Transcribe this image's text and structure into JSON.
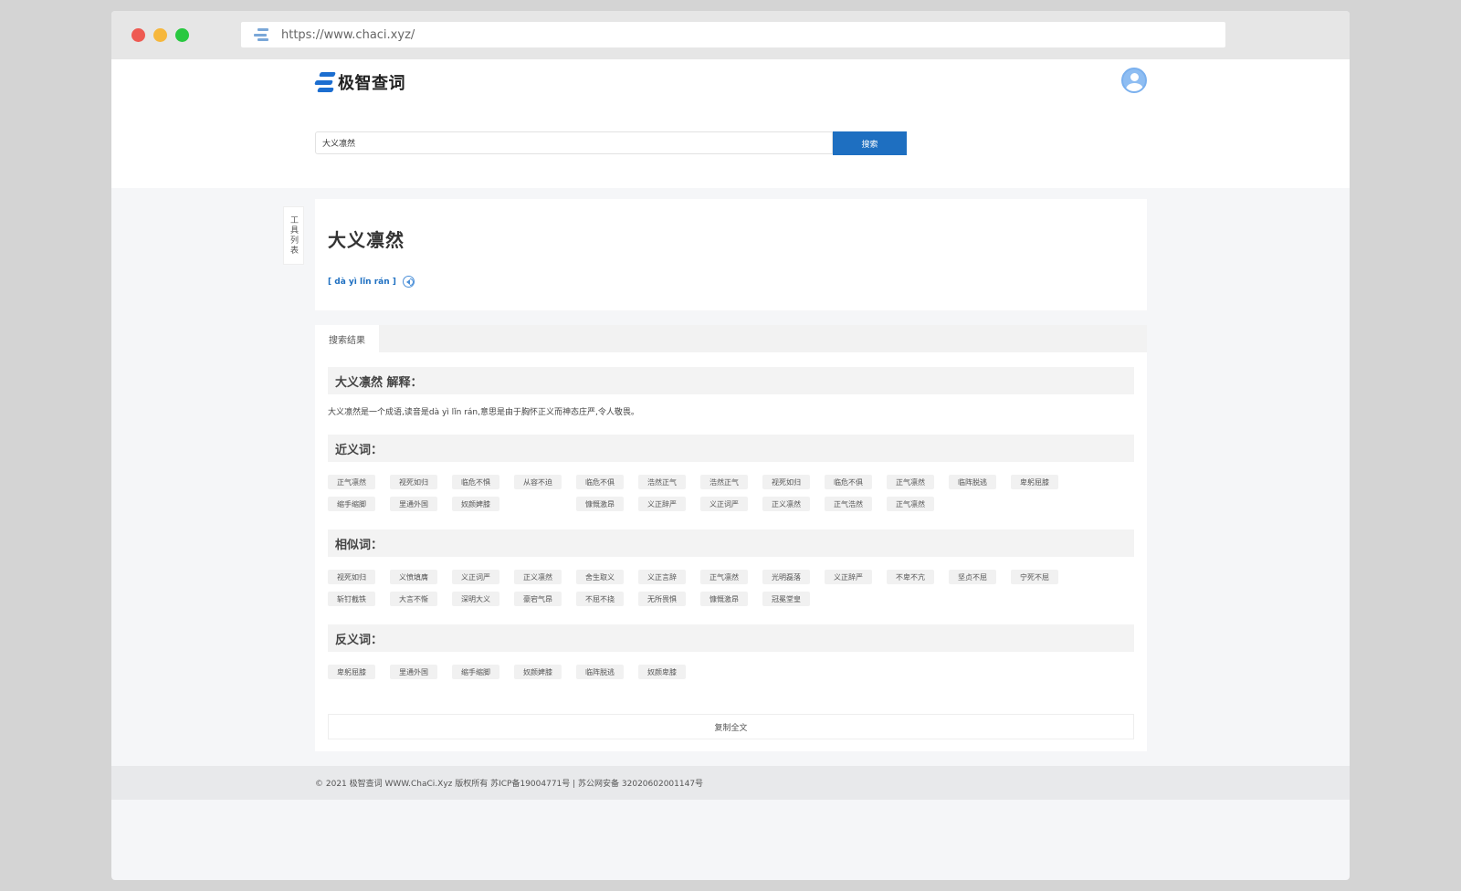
{
  "browser": {
    "url": "https://www.chaci.xyz/"
  },
  "header": {
    "logo_text": "极智查词"
  },
  "search": {
    "value": "大义凛然",
    "button_label": "搜索"
  },
  "side_tab": {
    "label": "工具列表"
  },
  "word": {
    "title": "大义凛然",
    "pinyin": "[ dà yì lǐn rán ]"
  },
  "results": {
    "tab_label": "搜索结果",
    "explain_heading": "大义凛然 解释：",
    "explain_text": "大义凛然是一个成语,读音是dà yì lǐn rán,意思是由于胸怀正义而神态庄严,令人敬畏。",
    "synonyms_heading": "近义词：",
    "synonyms": [
      "正气凛然",
      "视死如归",
      "临危不惧",
      "从容不迫",
      "临危不俱",
      "浩然正气",
      "浩然正气",
      "视死如归",
      "临危不俱",
      "正气凛然",
      "临阵脱逃",
      "卑躬屈膝",
      "缩手缩脚",
      "里通外国",
      "奴颜婢膝",
      "",
      "慷慨激昂",
      "义正辞严",
      "义正词严",
      "正义凛然",
      "正气浩然",
      "正气凛然"
    ],
    "similar_heading": "相似词：",
    "similar": [
      "视死如归",
      "义愤填膺",
      "义正词严",
      "正义凛然",
      "舍生取义",
      "义正言辞",
      "正气凛然",
      "光明磊落",
      "义正辞严",
      "不卑不亢",
      "坚贞不屈",
      "宁死不屈",
      "斩钉截铁",
      "大言不惭",
      "深明大义",
      "豪宕气昂",
      "不屈不挠",
      "无所畏惧",
      "慷慨激昂",
      "冠冕堂皇"
    ],
    "antonyms_heading": "反义词：",
    "antonyms": [
      "卑躬屈膝",
      "里通外国",
      "缩手缩脚",
      "奴颜婢膝",
      "临阵脱逃",
      "奴颜卑膝"
    ],
    "copy_label": "复制全文"
  },
  "footer": {
    "text": "© 2021 极智查词 WWW.ChaCi.Xyz 版权所有 苏ICP备19004771号 | 苏公网安备 32020602001147号"
  },
  "colors": {
    "accent": "#1e6fc1",
    "background": "#f5f6f8"
  }
}
